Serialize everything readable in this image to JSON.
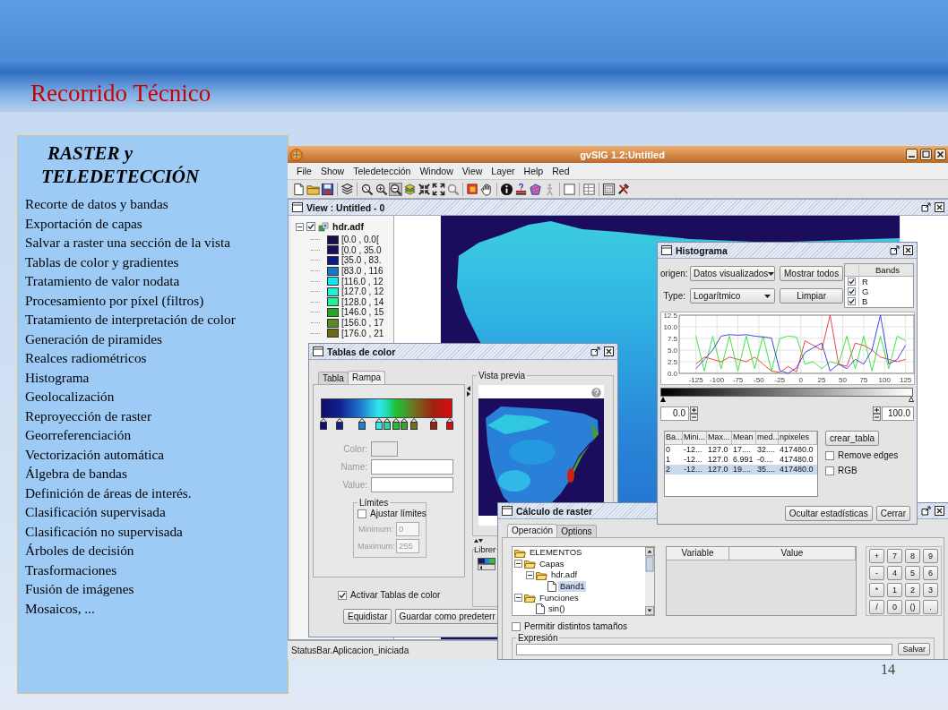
{
  "slide": {
    "title": "Recorrido Técnico",
    "page_number": "14"
  },
  "panel": {
    "heading": "RASTER y TELEDETECCIÓN",
    "items": [
      "Recorte de datos y bandas",
      "Exportación de capas",
      "Salvar a raster una sección de la vista",
      "Tablas de color y gradientes",
      "Tratamiento de valor nodata",
      "Procesamiento por píxel (filtros)",
      "Tratamiento de interpretación de color",
      "Generación de piramides",
      "Realces radiométricos",
      "Histograma",
      "Geolocalización",
      "Reproyección de raster",
      "Georreferenciación",
      "Vectorización automática",
      "Álgebra de bandas",
      "Definición de áreas de interés.",
      "Clasificación supervisada",
      "Clasificación no supervisada",
      "Árboles de decisión",
      "Trasformaciones",
      "Fusión de imágenes",
      "Mosaicos, ..."
    ]
  },
  "app": {
    "title": "gvSIG 1.2:Untitled",
    "menu": [
      "File",
      "Show",
      "Teledetección",
      "Window",
      "View",
      "Layer",
      "Help",
      "Red"
    ],
    "toolbar": [
      {
        "kind": "button",
        "selected": false
      },
      {
        "kind": "button",
        "selected": false
      },
      {
        "kind": "button",
        "selected": false
      },
      {
        "kind": "separator"
      },
      {
        "kind": "button",
        "selected": false
      },
      {
        "kind": "separator"
      },
      {
        "kind": "button",
        "selected": false
      },
      {
        "kind": "button",
        "selected": false
      },
      {
        "kind": "button",
        "selected": true
      },
      {
        "kind": "button",
        "selected": false
      },
      {
        "kind": "button",
        "selected": false
      },
      {
        "kind": "button",
        "selected": false
      },
      {
        "kind": "button",
        "selected": false
      },
      {
        "kind": "separator"
      },
      {
        "kind": "button",
        "selected": false
      },
      {
        "kind": "button",
        "selected": false
      },
      {
        "kind": "separator"
      },
      {
        "kind": "button",
        "selected": false
      },
      {
        "kind": "button",
        "selected": false
      },
      {
        "kind": "button",
        "selected": false
      },
      {
        "kind": "button",
        "selected": false
      },
      {
        "kind": "separator"
      },
      {
        "kind": "button",
        "selected": false
      },
      {
        "kind": "separator"
      },
      {
        "kind": "button",
        "selected": false
      },
      {
        "kind": "separator"
      },
      {
        "kind": "button",
        "selected": false
      },
      {
        "kind": "button",
        "selected": false
      }
    ],
    "view": {
      "title": "View : Untitled - 0",
      "layer": {
        "name": "hdr.adf",
        "expanded": true,
        "checked": true,
        "legend": [
          {
            "label": "[0.0 , 0.0[",
            "color": "#1c0c4e"
          },
          {
            "label": "[0.0 , 35.0",
            "color": "#1e0d5e"
          },
          {
            "label": "[35.0 , 83.",
            "color": "#0a1a8c"
          },
          {
            "label": "[83.0 , 116",
            "color": "#1878c8"
          },
          {
            "label": "[116.0 , 12",
            "color": "#10e8f0"
          },
          {
            "label": "[127.0 , 12",
            "color": "#20f0d8"
          },
          {
            "label": "[128.0 , 14",
            "color": "#20f098"
          },
          {
            "label": "[146.0 , 15",
            "color": "#20a820"
          },
          {
            "label": "[156.0 , 17",
            "color": "#5a8a20"
          },
          {
            "label": "[176.0 , 21",
            "color": "#6a6a10"
          }
        ]
      }
    },
    "status_bar": "StatusBar.Aplicacion_iniciada"
  },
  "histogram": {
    "title": "Histograma",
    "origin_label": "origen:",
    "origin_value": "Datos visualizados",
    "type_label": "Type:",
    "type_value": "Logarítmico",
    "show_all_button": "Mostrar todos",
    "clear_button": "Limpiar",
    "bands": {
      "header": "Bands",
      "rows": [
        {
          "checked": true
        },
        {
          "checked": true
        },
        {
          "checked": true
        }
      ]
    },
    "chart_data": {
      "type": "line",
      "x": [
        -125,
        -115,
        -105,
        -95,
        -85,
        -75,
        -65,
        -55,
        -45,
        -35,
        -25,
        -15,
        -5,
        5,
        15,
        25,
        35,
        45,
        55,
        65,
        75,
        85,
        95,
        105,
        115,
        125
      ],
      "series": [
        {
          "name": "R",
          "color": "#e83030",
          "values": [
            2,
            3.5,
            3,
            2.5,
            3.5,
            3,
            2.5,
            3.5,
            2,
            0.5,
            0.2,
            1.5,
            0.3,
            7,
            6,
            5,
            12.5,
            2,
            1.5,
            6.5,
            6,
            5,
            3.5,
            3,
            2.5,
            3
          ]
        },
        {
          "name": "G",
          "color": "#30e030",
          "values": [
            8,
            0.5,
            8,
            1,
            8,
            0.5,
            8,
            1,
            8,
            0.5,
            7.5,
            8,
            7.8,
            2,
            2.5,
            1,
            2.5,
            2,
            8,
            1,
            8,
            0.5,
            8,
            1,
            8,
            7
          ]
        },
        {
          "name": "B",
          "color": "#3030e0",
          "values": [
            1,
            3,
            5,
            8,
            8.3,
            8.2,
            8.3,
            8,
            7.8,
            7.6,
            0.6,
            0,
            1.2,
            4.5,
            5.5,
            6.5,
            0.5,
            2,
            1,
            3,
            2,
            5,
            12.5,
            2,
            3,
            6
          ]
        }
      ],
      "xlim": [
        -145,
        135
      ],
      "ylim": [
        0,
        12.5
      ],
      "xticks": [
        -125,
        -100,
        -75,
        -50,
        -25,
        0,
        25,
        50,
        75,
        100,
        125
      ],
      "yticks": [
        {
          "value": 0,
          "label": "0.0"
        },
        {
          "value": 2.5,
          "label": "2.5"
        },
        {
          "value": 5,
          "label": "5.0"
        },
        {
          "value": 7.5,
          "label": "7.5"
        },
        {
          "value": 10,
          "label": "10.0"
        },
        {
          "value": 12.5,
          "label": "12.5"
        }
      ],
      "grid": true
    },
    "min_value": "0.0",
    "max_value": "100.0",
    "stats": {
      "columns": [
        "Ba...",
        "Mini...",
        "Max...",
        "Mean",
        "med...",
        "npixeles"
      ],
      "rows": [
        {
          "cells": [
            "0",
            "-12...",
            "127.0",
            "17....",
            "32....",
            "417480.0"
          ],
          "selected": false
        },
        {
          "cells": [
            "1",
            "-12...",
            "127.0",
            "6.991",
            "-0....",
            "417480.0"
          ],
          "selected": false
        },
        {
          "cells": [
            "2",
            "-12...",
            "127.0",
            "19....",
            "35....",
            "417480.0"
          ],
          "selected": true
        }
      ]
    },
    "create_table_button": "crear_tabla",
    "options": [
      {
        "label": "Remove edges",
        "checked": false
      },
      {
        "label": "RGB",
        "checked": false
      }
    ],
    "hide_stats_button": "Ocultar estadísticas",
    "close_button": "Cerrar"
  },
  "color_tables": {
    "title": "Tablas de color",
    "tabs": [
      {
        "label": "Tabla",
        "selected": false
      },
      {
        "label": "Rampa",
        "selected": true
      }
    ],
    "ramp": [
      {
        "color": "#101070"
      },
      {
        "color": "#102090"
      },
      {
        "color": "#2080d0"
      },
      {
        "color": "#30e8f0"
      },
      {
        "color": "#20d8a8"
      },
      {
        "color": "#20c030"
      },
      {
        "color": "#40a030"
      },
      {
        "color": "#707020"
      },
      {
        "color": "#a02010"
      },
      {
        "color": "#d01010"
      }
    ],
    "fields": [
      {
        "label": "Color:",
        "kind": "swatch",
        "disabled": true
      },
      {
        "label": "Name:",
        "kind": "text",
        "disabled": true
      },
      {
        "label": "Value:",
        "kind": "text",
        "disabled": true
      }
    ],
    "limits": {
      "title": "Límites",
      "adjust": {
        "label": "Ajustar límites",
        "checked": false
      },
      "min": {
        "label": "Minimum:",
        "value": "0"
      },
      "max": {
        "label": "Maximum:",
        "value": "255"
      },
      "disabled": true
    },
    "activate": {
      "label": "Activar Tablas de color",
      "checked": true
    },
    "equidistant_button": "Equidistar",
    "save_default_button": "Guardar como predeterr",
    "preview_title": "Vista previa",
    "library_title": "Librer"
  },
  "raster_calc": {
    "title": "Cálculo de raster",
    "tabs": [
      {
        "label": "Operación",
        "selected": true
      },
      {
        "label": "Options",
        "selected": false
      }
    ],
    "tree": [
      {
        "label": "ELEMENTOS",
        "kind": "folder",
        "expanded": true,
        "selected": false,
        "children": [
          {
            "label": "Capas",
            "kind": "folder",
            "expanded": true,
            "selected": false,
            "children": [
              {
                "label": "hdr.adf",
                "kind": "folder",
                "expanded": true,
                "selected": false,
                "children": [
                  {
                    "label": "Band1",
                    "kind": "file",
                    "selected": true
                  }
                ]
              }
            ]
          },
          {
            "label": "Funciones",
            "kind": "folder",
            "expanded": true,
            "selected": false,
            "children": [
              {
                "label": "sin()",
                "kind": "file",
                "selected": false
              }
            ]
          }
        ]
      }
    ],
    "variables_columns": [
      "Variable",
      "Value"
    ],
    "keypad": [
      "+",
      "7",
      "8",
      "9",
      "-",
      "4",
      "5",
      "6",
      "*",
      "1",
      "2",
      "3",
      "/",
      "0",
      "()",
      "."
    ],
    "allow_sizes": {
      "label": "Permitir distintos tamaños",
      "checked": false
    },
    "expression_title": "Expresión",
    "save_button": "Salvar"
  }
}
